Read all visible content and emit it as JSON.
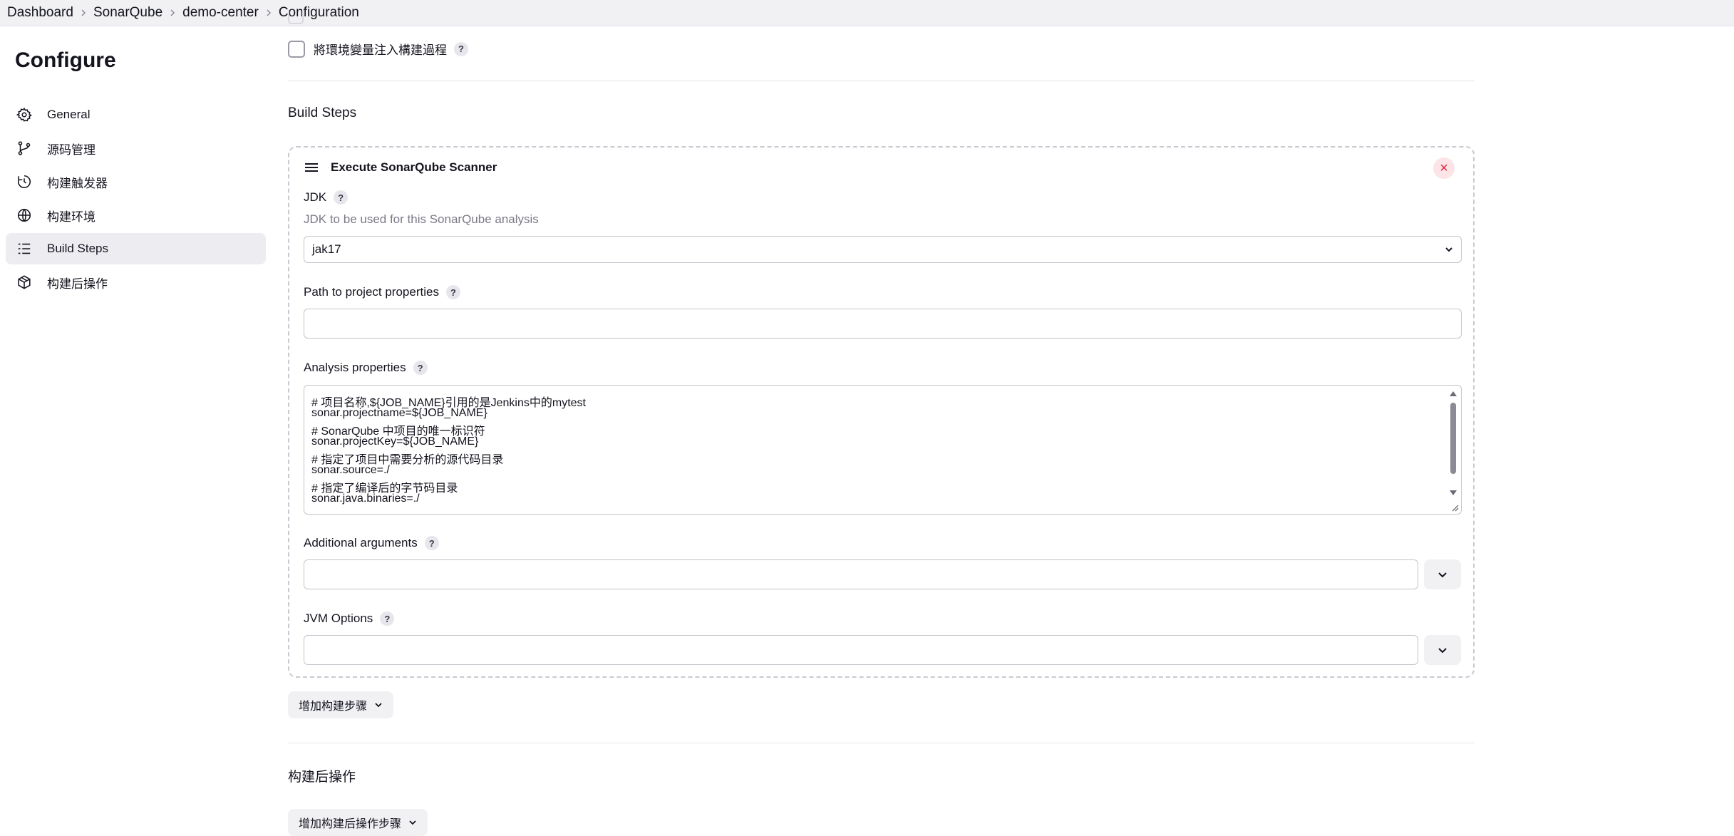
{
  "breadcrumb": {
    "items": [
      "Dashboard",
      "SonarQube",
      "demo-center",
      "Configuration"
    ]
  },
  "sidebar": {
    "title": "Configure",
    "items": [
      {
        "label": "General",
        "icon": "gear-icon"
      },
      {
        "label": "源码管理",
        "icon": "git-branch-icon"
      },
      {
        "label": "构建触发器",
        "icon": "clock-icon"
      },
      {
        "label": "构建环境",
        "icon": "globe-icon"
      },
      {
        "label": "Build Steps",
        "icon": "list-icon",
        "active": true
      },
      {
        "label": "构建后操作",
        "icon": "package-icon"
      }
    ]
  },
  "env": {
    "inject_label": "將環境變量注入構建過程",
    "help": "?"
  },
  "build_steps": {
    "heading": "Build Steps",
    "step": {
      "title": "Execute SonarQube Scanner",
      "close": "×",
      "jdk": {
        "label": "JDK",
        "description": "JDK to be used for this SonarQube analysis",
        "value": "jak17"
      },
      "path_props": {
        "label": "Path to project properties",
        "value": ""
      },
      "analysis": {
        "label": "Analysis properties",
        "lines": [
          "# 项目名称,${JOB_NAME}引用的是Jenkins中的mytest",
          "sonar.projectname=${JOB_NAME}",
          "# SonarQube 中项目的唯一标识符",
          "sonar.projectKey=${JOB_NAME}",
          "# 指定了项目中需要分析的源代码目录",
          "sonar.source=./",
          "# 指定了编译后的字节码目录",
          "sonar.java.binaries=./"
        ]
      },
      "additional_args": {
        "label": "Additional arguments",
        "value": ""
      },
      "jvm_options": {
        "label": "JVM Options",
        "value": ""
      }
    },
    "add_step_label": "增加构建步骤"
  },
  "post_build": {
    "heading": "构建后操作",
    "add_label": "增加构建后操作步骤"
  }
}
